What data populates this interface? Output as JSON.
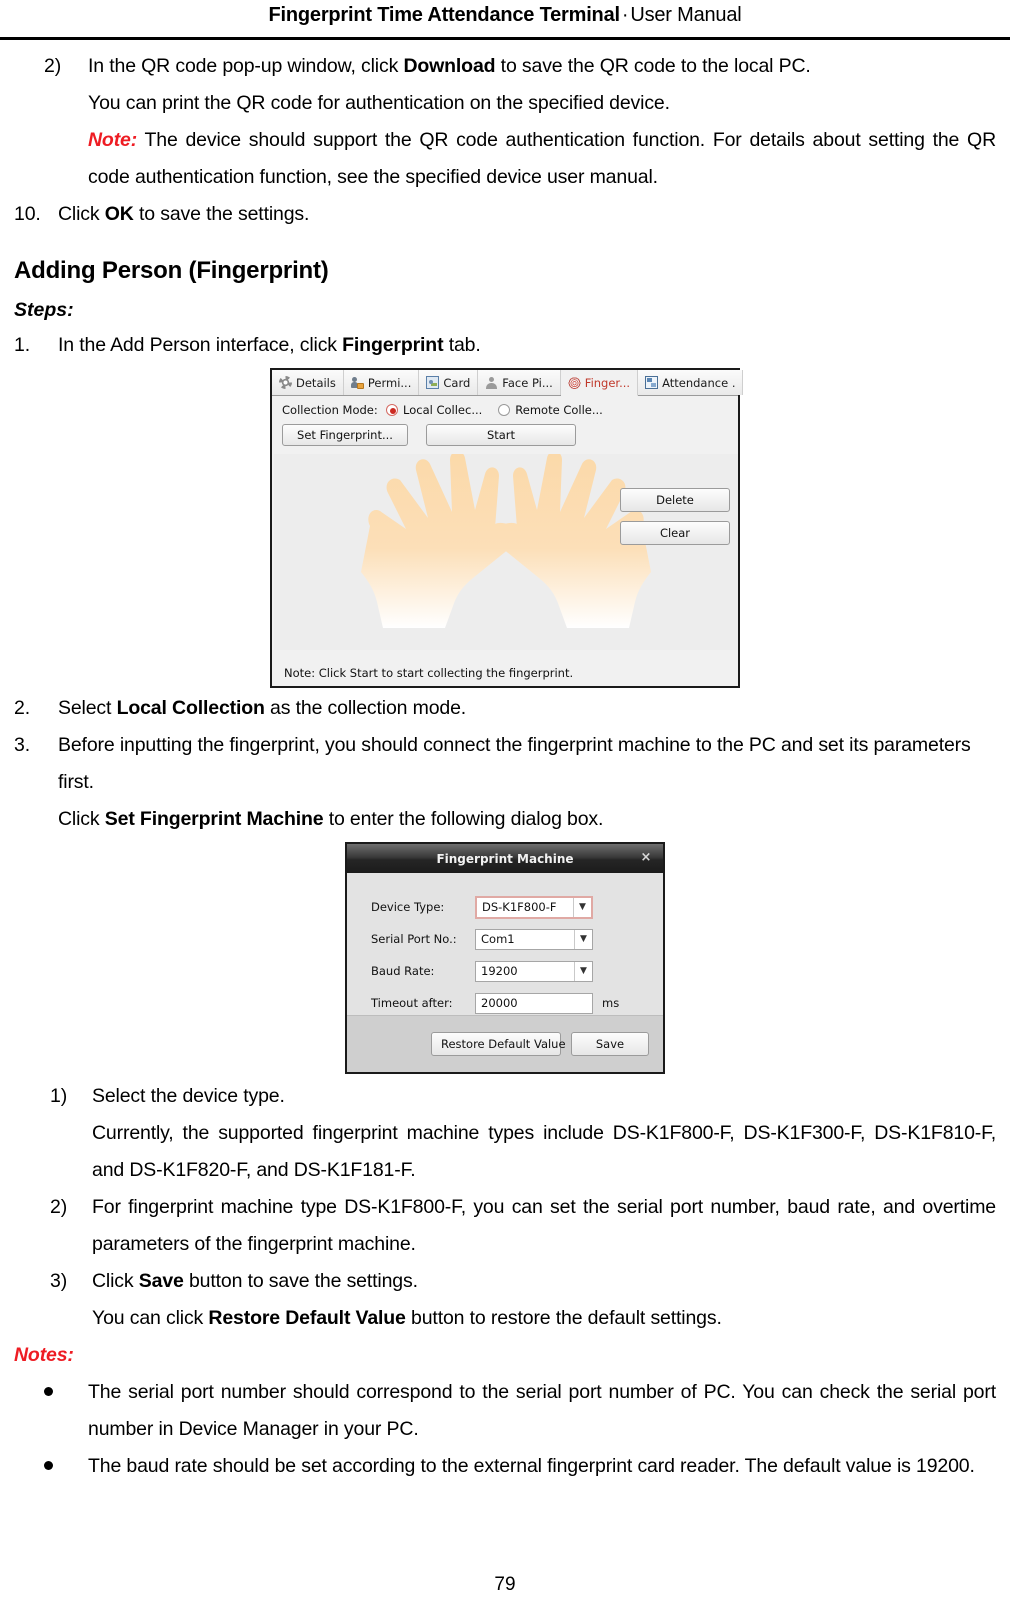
{
  "header": {
    "title_bold": "Fingerprint Time Attendance Terminal",
    "separator": "·",
    "title_rest": "User Manual"
  },
  "body": {
    "step2": {
      "marker": "2)",
      "line1_a": "In the QR code pop-up window, click ",
      "line1_b": "Download",
      "line1_c": " to save the QR code to the local PC.",
      "line2": "You can print the QR code for authentication on the specified device.",
      "note_label": "Note:",
      "note_text": " The device should support the QR code authentication function. For details about setting the QR code authentication function, see the specified device user manual."
    },
    "step10": {
      "marker": "10.",
      "text_a": "Click ",
      "text_b": "OK",
      "text_c": " to save the settings."
    },
    "section_title": "Adding Person (Fingerprint)",
    "steps_label": "Steps:",
    "step1": {
      "marker": "1.",
      "text_a": "In the Add Person interface, click ",
      "text_b": "Fingerprint",
      "text_c": " tab."
    },
    "step2b": {
      "marker": "2.",
      "text_a": "Select ",
      "text_b": "Local Collection",
      "text_c": " as the collection mode."
    },
    "step3": {
      "marker": "3.",
      "line1": "Before inputting the fingerprint, you should connect the fingerprint machine to the PC and set its parameters first.",
      "line2_a": "Click ",
      "line2_b": "Set Fingerprint Machine",
      "line2_c": " to enter the following dialog box."
    },
    "sub1": {
      "marker": "1)",
      "line1": "Select the device type.",
      "line2": "Currently, the supported fingerprint machine types include DS-K1F800-F, DS-K1F300-F, DS-K1F810-F, and DS-K1F820-F, and DS-K1F181-F."
    },
    "sub2": {
      "marker": "2)",
      "line1": "For fingerprint machine type DS-K1F800-F, you can set the serial port number, baud rate, and overtime parameters of the fingerprint machine."
    },
    "sub3": {
      "marker": "3)",
      "line1_a": "Click ",
      "line1_b": "Save",
      "line1_c": " button to save the settings.",
      "line2_a": "You can click ",
      "line2_b": "Restore Default Value",
      "line2_c": " button to restore the default settings."
    },
    "notes_label": "Notes:",
    "notes": [
      "The serial port number should correspond to the serial port number of PC. You can check the serial port number in Device Manager in your PC.",
      "The baud rate should be set according to the external fingerprint card reader. The default value is 19200."
    ]
  },
  "screenshot_fingerprint_tab": {
    "tabs": [
      {
        "label": "Details",
        "icon": "gear-icon",
        "active": false
      },
      {
        "label": "Permi...",
        "icon": "permission-icon",
        "active": false
      },
      {
        "label": "Card",
        "icon": "card-icon",
        "active": false
      },
      {
        "label": "Face Pi...",
        "icon": "face-picture-icon",
        "active": false
      },
      {
        "label": "Finger...",
        "icon": "fingerprint-icon",
        "active": true
      },
      {
        "label": "Attendance .",
        "icon": "attendance-icon",
        "active": false
      }
    ],
    "collection_mode_label": "Collection Mode:",
    "radio_local": "Local Collec...",
    "radio_remote": "Remote Colle...",
    "radio_selected": "Local Collec...",
    "btn_set_fingerprint": "Set Fingerprint...",
    "btn_start": "Start",
    "btn_delete": "Delete",
    "btn_clear": "Clear",
    "note": "Note: Click Start to start collecting the fingerprint.",
    "hand_color": "#fbdcb0",
    "panel_bg": "#ededed",
    "active_tab_color": "#c0392b"
  },
  "screenshot_fingerprint_machine": {
    "title": "Fingerprint Machine",
    "close_glyph": "×",
    "fields": [
      {
        "label": "Device Type:",
        "value": "DS-K1F800-F",
        "type": "select",
        "focused": true
      },
      {
        "label": "Serial Port No.:",
        "value": "Com1",
        "type": "select",
        "focused": false
      },
      {
        "label": "Baud Rate:",
        "value": "19200",
        "type": "select",
        "focused": false
      },
      {
        "label": "Timeout after:",
        "value": "20000",
        "type": "text",
        "unit": "ms",
        "focused": false
      }
    ],
    "btn_restore": "Restore Default Value",
    "btn_save": "Save",
    "focus_border_color": "#e0a9a4"
  },
  "footer": {
    "page_number": "79"
  }
}
